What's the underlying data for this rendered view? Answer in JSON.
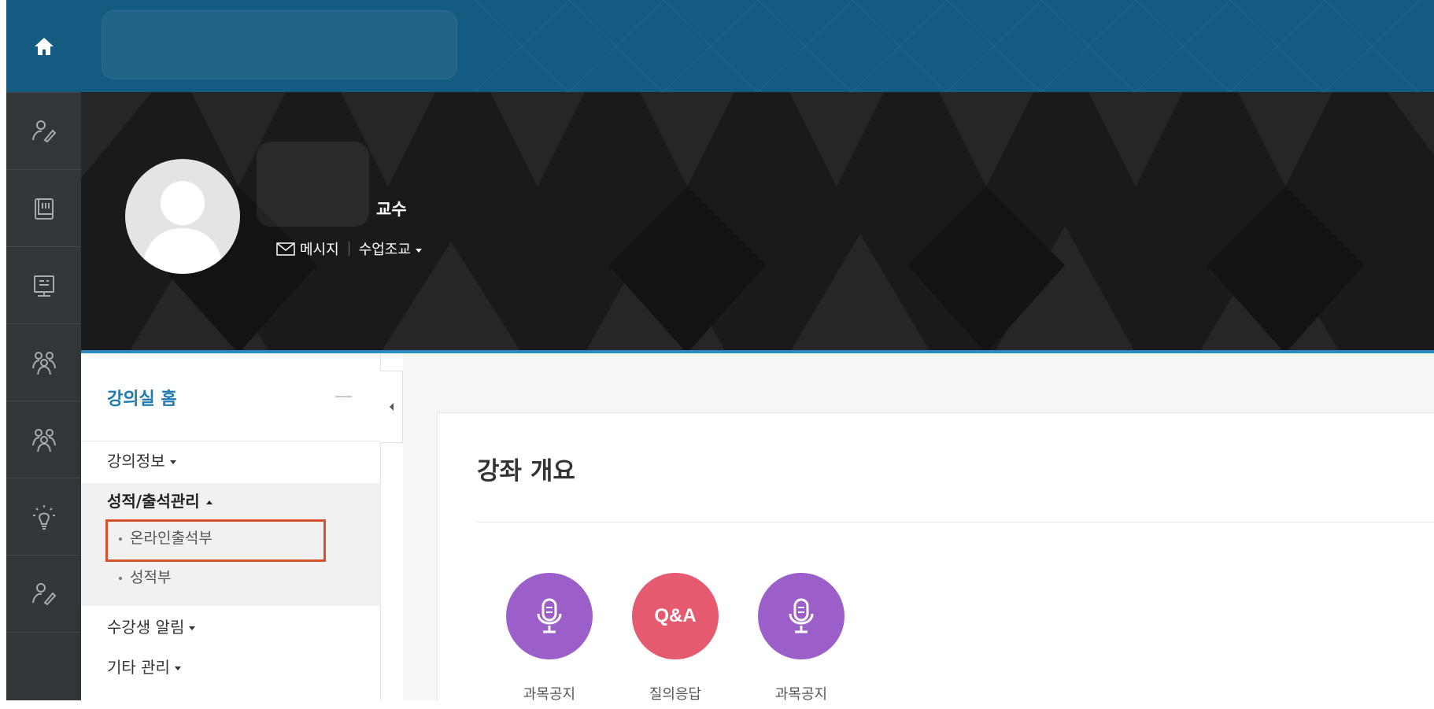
{
  "nav_rail": {
    "icons": [
      "home-icon",
      "person-edit-icon",
      "book-icon",
      "presentation-icon",
      "group-icon",
      "group-icon",
      "lightbulb-icon",
      "person-edit-icon"
    ]
  },
  "profile": {
    "role": "교수",
    "message_link": "메시지",
    "assistant_link": "수업조교"
  },
  "sidebar": {
    "title": "강의실 홈",
    "items": [
      {
        "label": "강의정보"
      },
      {
        "label": "성적/출석관리"
      },
      {
        "label": "수강생 알림"
      },
      {
        "label": "기타 관리"
      }
    ],
    "subitems": [
      {
        "label": "온라인출석부"
      },
      {
        "label": "성적부"
      }
    ]
  },
  "main": {
    "section_title": "강좌 개요",
    "activities": [
      {
        "label": "과목공지",
        "icon": "microphone-icon",
        "color": "#9c5fc9"
      },
      {
        "label": "질의응답",
        "icon_text": "Q&A",
        "color": "#e55a6e"
      },
      {
        "label": "과목공지",
        "icon": "microphone-icon",
        "color": "#9c5fc9"
      }
    ]
  },
  "colors": {
    "header_blue": "#135b80",
    "rail_dark": "#333638",
    "sidebar_title": "#1e7ab0",
    "highlight_box": "#d9512c"
  }
}
